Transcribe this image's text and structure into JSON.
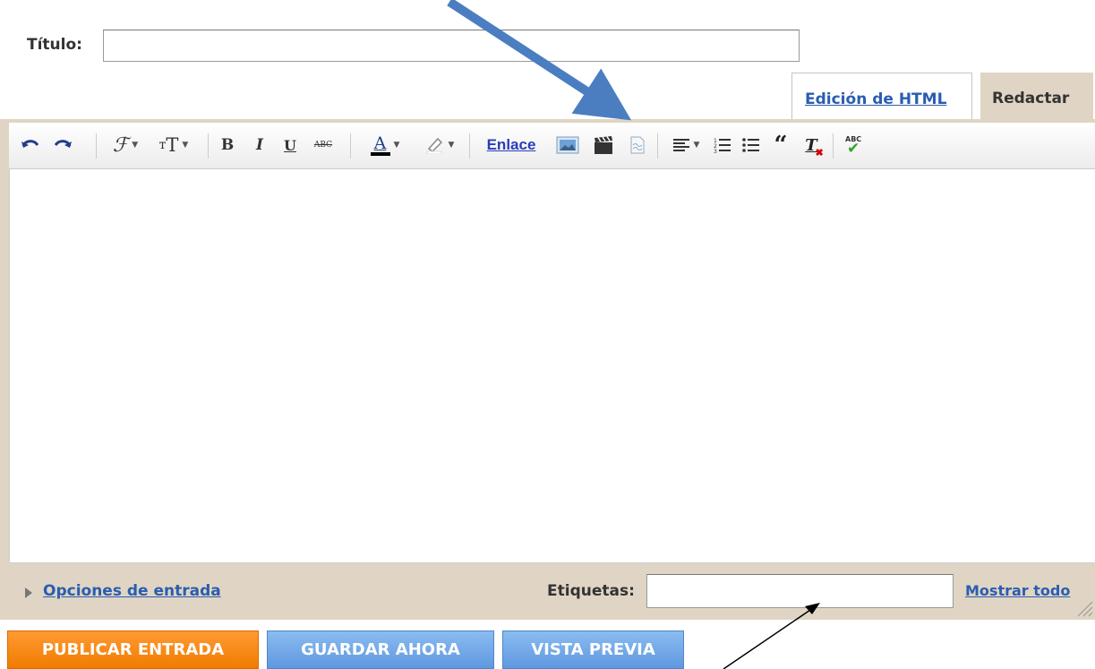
{
  "title_field": {
    "label": "Título:",
    "value": ""
  },
  "mode_tabs": {
    "html_label": "Edición de HTML",
    "compose_label": "Redactar"
  },
  "toolbar": {
    "link_label": "Enlace",
    "icons": [
      "undo-icon",
      "redo-icon",
      "font-family-icon",
      "font-size-icon",
      "bold-icon",
      "italic-icon",
      "underline-icon",
      "strikethrough-icon",
      "text-color-icon",
      "highlight-icon",
      "insert-image-icon",
      "insert-video-icon",
      "jump-break-icon",
      "align-icon",
      "numbered-list-icon",
      "bulleted-list-icon",
      "quote-icon",
      "remove-formatting-icon",
      "spellcheck-icon"
    ]
  },
  "editor": {
    "content": ""
  },
  "footer": {
    "post_options_label": "Opciones de entrada",
    "labels_label": "Etiquetas:",
    "labels_value": "",
    "show_all_label": "Mostrar todo"
  },
  "actions": {
    "publish_label": "PUBLICAR ENTRADA",
    "save_label": "GUARDAR AHORA",
    "preview_label": "VISTA PREVIA"
  },
  "colors": {
    "accent_orange": "#f07c00",
    "button_blue": "#5e98e0",
    "frame_beige": "#e0d5c4",
    "link_blue": "#2a5db0",
    "annotation_arrow": "#4a7ec0"
  }
}
